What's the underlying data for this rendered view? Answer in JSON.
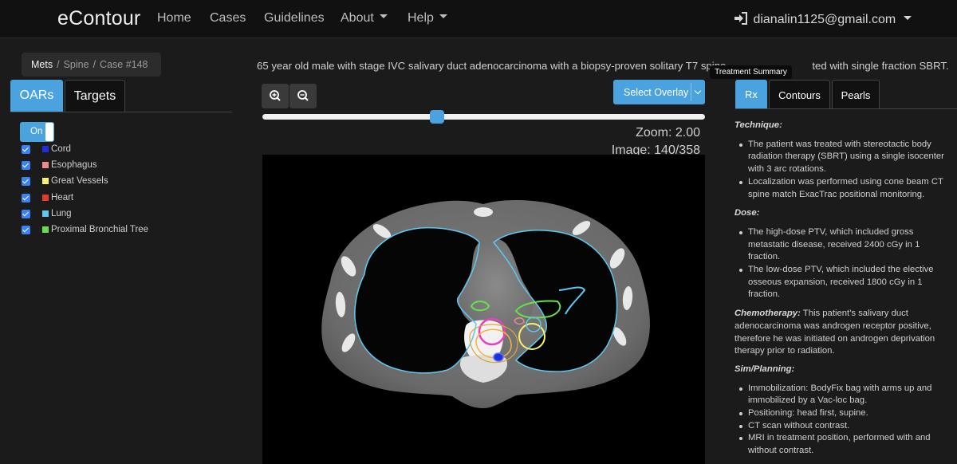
{
  "nav": {
    "brand": "eContour",
    "links": [
      "Home",
      "Cases",
      "Guidelines",
      "About",
      "Help"
    ],
    "user_email": "dianalin1125@gmail.com"
  },
  "breadcrumb": [
    "Mets",
    "Spine",
    "Case #148"
  ],
  "left_tabs": [
    "OARs",
    "Targets"
  ],
  "toggle_label": "On",
  "oars": [
    {
      "label": "Cord",
      "color": "#1f2fe0",
      "checked": true
    },
    {
      "label": "Esophagus",
      "color": "#f08a8a",
      "checked": true
    },
    {
      "label": "Great Vessels",
      "color": "#f6f26a",
      "checked": true
    },
    {
      "label": "Heart",
      "color": "#e53b2e",
      "checked": true
    },
    {
      "label": "Lung",
      "color": "#5ec8f0",
      "checked": true
    },
    {
      "label": "Proximal Bronchial Tree",
      "color": "#69e04b",
      "checked": true
    }
  ],
  "case_description": "65 year old male with stage IVC salivary duct adenocarcinoma with a biopsy-proven solitary T7 spine",
  "case_description_tail": "ted with single fraction SBRT.",
  "tooltip": "Treatment Summary",
  "overlay_button": "Select Overlay",
  "slider": {
    "value": 140,
    "max": 358
  },
  "zoom_label": "Zoom: 2.00",
  "image_label": "Image: 140/358",
  "right_tabs": [
    "Rx",
    "Contours",
    "Pearls"
  ],
  "rx": {
    "technique_heading": "Technique:",
    "technique_items": [
      "The patient was treated with stereotactic body radiation therapy (SBRT) using a single isocenter with 3 arc rotations.",
      "Localization was performed using cone beam CT spine match ExacTrac positional monitoring."
    ],
    "dose_heading": "Dose:",
    "dose_items": [
      "The high-dose PTV, which included gross metastatic disease, received 2400 cGy in 1 fraction.",
      "The low-dose PTV, which included the elective osseous expansion, received 1800 cGy in 1 fraction."
    ],
    "chemo_heading": "Chemotherapy:",
    "chemo_text": " This patient's salivary duct adenocarcinoma was androgen receptor positive, therefore he was initiated on androgen deprivation therapy prior to radiation.",
    "sim_heading": "Sim/Planning:",
    "sim_items": [
      "Immobilization: BodyFix bag with arms up and immobilized by a Vac-loc bag.",
      "Positioning: head first, supine.",
      "CT scan without contrast.",
      "MRI in treatment position, performed with and without contrast."
    ]
  }
}
